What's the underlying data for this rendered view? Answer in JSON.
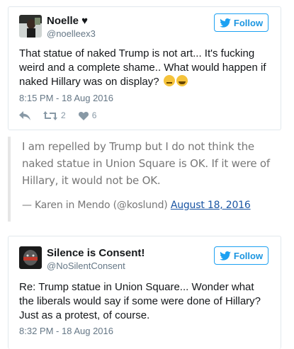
{
  "tweet1": {
    "name": "Noelle ♥",
    "handle": "@noelleex3",
    "follow_label": "Follow",
    "text_line1": "That statue of naked Trump is not art... It's fucking",
    "text_line2": "weird and a complete shame.. What would happen if",
    "text_line3": "naked Hillary was on display?",
    "timestamp": "8:15 PM - 18 Aug 2016",
    "retweet_count": "2",
    "like_count": "6"
  },
  "quote": {
    "line1": "I am repelled by Trump but I do not think the",
    "line2": "naked statue in Union Square is OK. If it were of",
    "line3": "Hillary, it would not be OK.",
    "attribution": "— Karen in Mendo (@koslund)",
    "date_link": "August 18, 2016"
  },
  "tweet2": {
    "name": "Silence is Consent!",
    "handle": "@NoSilentConsent",
    "follow_label": "Follow",
    "text_line1": "Re: Trump statue in Union Square... Wonder what",
    "text_line2": "the liberals would say if some were done of Hillary?",
    "text_line3": "Just as a protest, of course.",
    "timestamp": "8:32 PM - 18 Aug 2016"
  },
  "colors": {
    "twitter_blue": "#1da1f2",
    "link": "#1a55a3",
    "muted": "#657786"
  }
}
